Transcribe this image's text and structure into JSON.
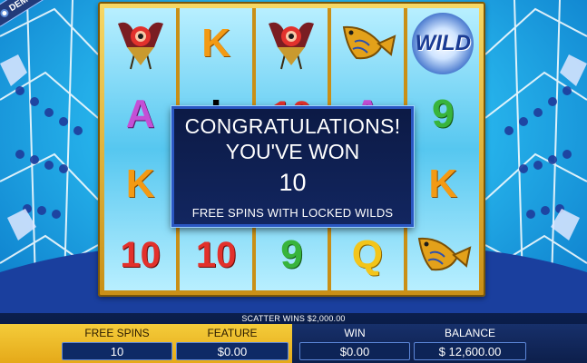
{
  "demo_badge": {
    "label": "DEMO"
  },
  "reels": [
    [
      "bird",
      "A",
      "K",
      "10"
    ],
    [
      "K",
      "I",
      "A",
      "10"
    ],
    [
      "bird",
      "10",
      "A",
      "9"
    ],
    [
      "fish",
      "A",
      "A",
      "Q"
    ],
    [
      "WILD",
      "9",
      "K",
      "fish"
    ]
  ],
  "popup": {
    "line1": "CONGRATULATIONS!",
    "line2": "YOU'VE WON",
    "count": "10",
    "detail": "FREE SPINS WITH LOCKED WILDS"
  },
  "status": {
    "scatter_wins": "SCATTER WINS $2,000.00"
  },
  "meters": {
    "free_spins": {
      "label": "FREE SPINS",
      "value": "10"
    },
    "feature": {
      "label": "FEATURE",
      "value": "$0.00"
    },
    "win": {
      "label": "WIN",
      "value": "$0.00"
    },
    "balance": {
      "label": "BALANCE",
      "value": "$ 12,600.00"
    }
  },
  "colors": {
    "frame_gold": "#e5a919",
    "popup_bg": "#0c1a45",
    "letter_K": "#f39a14",
    "letter_A": "#c44fd6",
    "letter_Q": "#f3c51a",
    "num_10": "#e2312c",
    "num_9": "#38b43c"
  }
}
